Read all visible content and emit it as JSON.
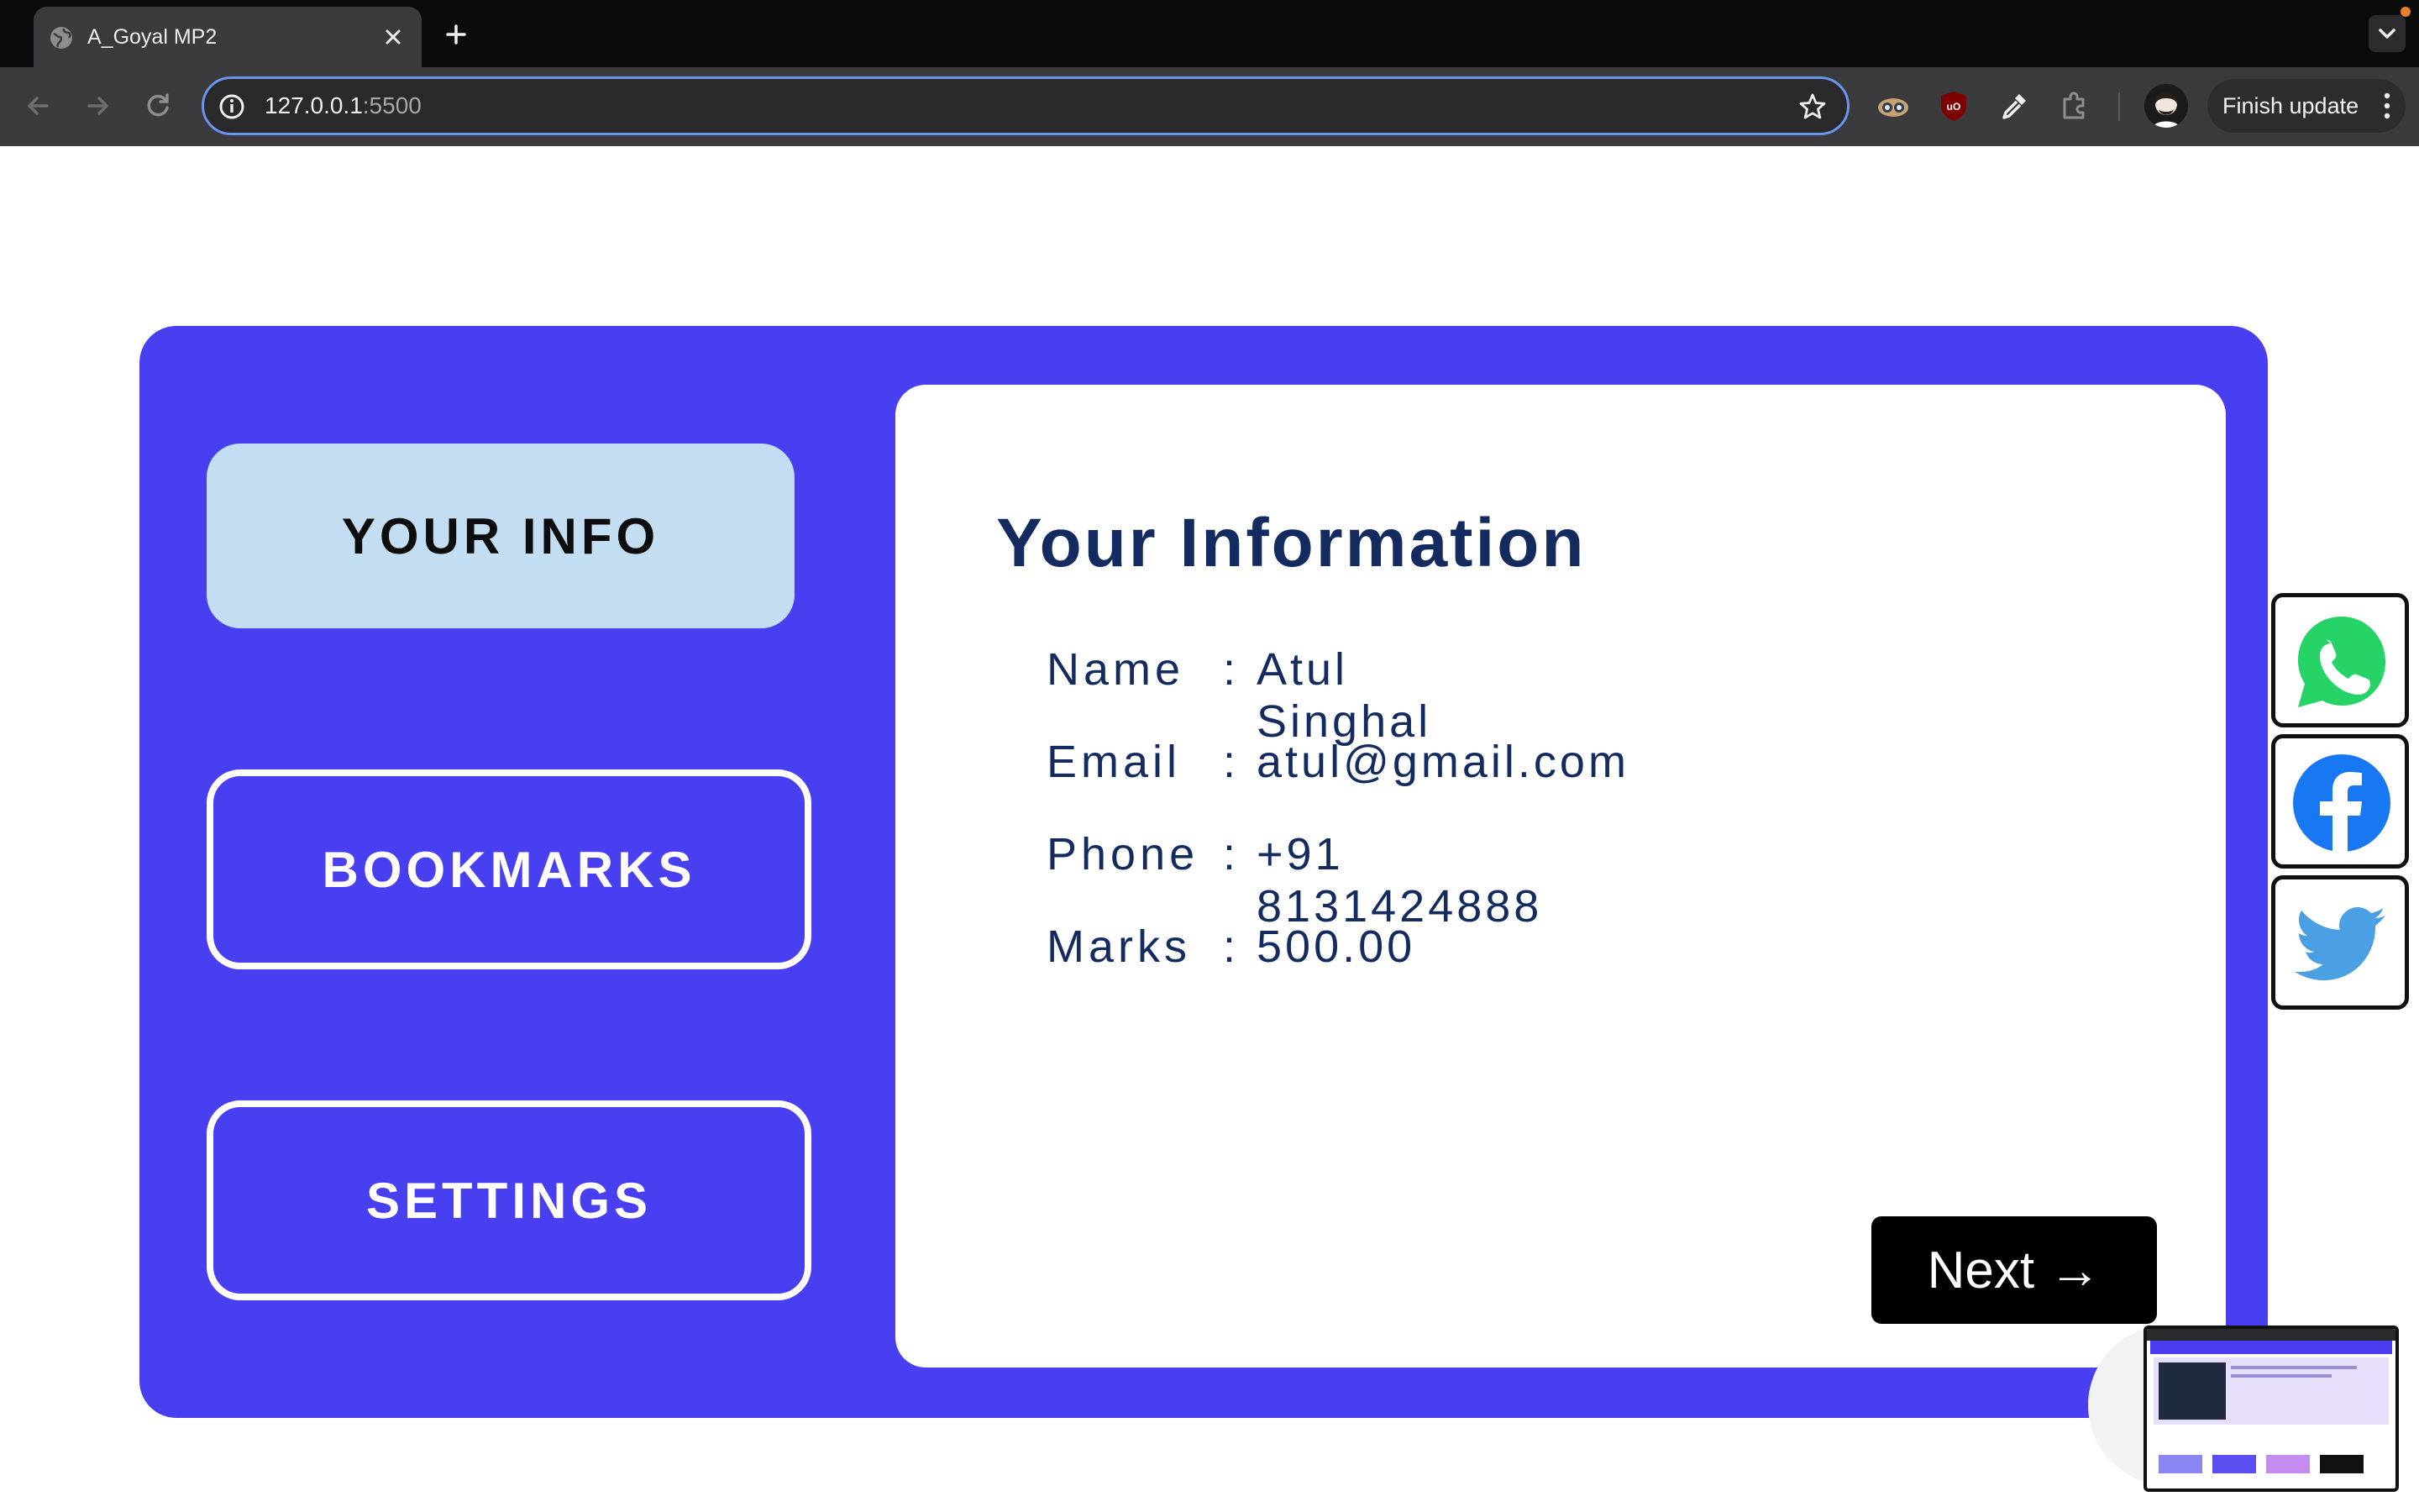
{
  "browser": {
    "tab_title": "A_Goyal MP2",
    "url_host": "127.0.0.1",
    "url_port": ":5500",
    "finish_update_label": "Finish update"
  },
  "sidebar": {
    "items": [
      {
        "label": "YOUR INFO",
        "active": true
      },
      {
        "label": "BOOKMARKS",
        "active": false
      },
      {
        "label": "SETTINGS",
        "active": false
      }
    ]
  },
  "panel": {
    "title": "Your Information",
    "rows": [
      {
        "label": "Name",
        "value": "Atul Singhal"
      },
      {
        "label": "Email",
        "value": "atul@gmail.com"
      },
      {
        "label": "Phone",
        "value": "+91 8131424888"
      },
      {
        "label": "Marks",
        "value": "500.00"
      }
    ],
    "separator": ":",
    "next_label": "Next →"
  },
  "social": [
    "whatsapp-icon",
    "facebook-icon",
    "twitter-icon"
  ],
  "colors": {
    "page_bg": "#ffffff",
    "card_bg": "#473ff0",
    "active_tab_bg": "#c3def3",
    "heading_text": "#132b5f",
    "next_bg": "#000000",
    "whatsapp": "#25d366",
    "facebook": "#1877f2",
    "twitter": "#4b9fe3"
  }
}
